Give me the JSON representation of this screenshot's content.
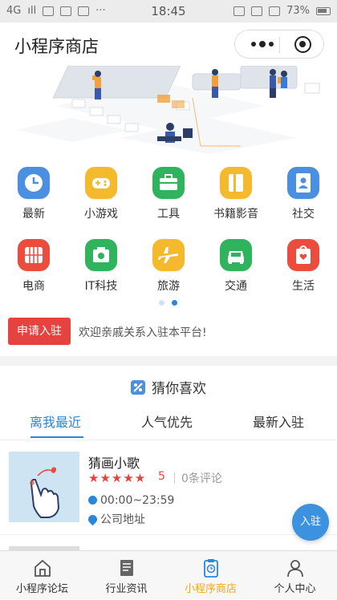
{
  "status_bar": {
    "network": "4G",
    "signal": "ıll",
    "data_badge": "%",
    "time": "18:45",
    "battery_percent": "73%"
  },
  "nav": {
    "title": "小程序商店"
  },
  "categories": [
    {
      "label": "最新",
      "icon": "clock-icon",
      "color": "#4a8fe0"
    },
    {
      "label": "小游戏",
      "icon": "gamepad-icon",
      "color": "#f5b92e"
    },
    {
      "label": "工具",
      "icon": "toolbox-icon",
      "color": "#2fb35c"
    },
    {
      "label": "书籍影音",
      "icon": "book-icon",
      "color": "#f5b92e"
    },
    {
      "label": "社交",
      "icon": "contact-card-icon",
      "color": "#4a8fe0"
    },
    {
      "label": "电商",
      "icon": "globe-icon",
      "color": "#ea4c3e"
    },
    {
      "label": "IT科技",
      "icon": "camera-icon",
      "color": "#2fb35c"
    },
    {
      "label": "旅游",
      "icon": "airplane-icon",
      "color": "#f5b92e"
    },
    {
      "label": "交通",
      "icon": "car-icon",
      "color": "#2fb35c"
    },
    {
      "label": "生活",
      "icon": "heart-bag-icon",
      "color": "#ea4c3e"
    }
  ],
  "pager": {
    "count": 2,
    "active_index": 1
  },
  "notice": {
    "apply_label": "申请入驻",
    "text": "欢迎亲戚关系入驻本平台!"
  },
  "section": {
    "title": "猜你喜欢",
    "tabs": [
      {
        "label": "离我最近",
        "active": true
      },
      {
        "label": "人气优先",
        "active": false
      },
      {
        "label": "最新入驻",
        "active": false
      }
    ]
  },
  "listing": {
    "name": "猜画小歌",
    "stars": "★★★★★",
    "score": "5",
    "reviews": "0条评论",
    "hours": "00:00~23:59",
    "address": "公司地址"
  },
  "fab": {
    "label": "入驻"
  },
  "tabbar": [
    {
      "label": "小程序论坛",
      "icon": "house-icon",
      "active": false
    },
    {
      "label": "行业资讯",
      "icon": "document-icon",
      "active": false
    },
    {
      "label": "小程序商店",
      "icon": "clipboard-clock-icon",
      "active": true
    },
    {
      "label": "个人中心",
      "icon": "person-icon",
      "active": false
    }
  ],
  "colors": {
    "accent_blue": "#2a86d8",
    "accent_red": "#e64340",
    "accent_yellow": "#f0a818"
  }
}
